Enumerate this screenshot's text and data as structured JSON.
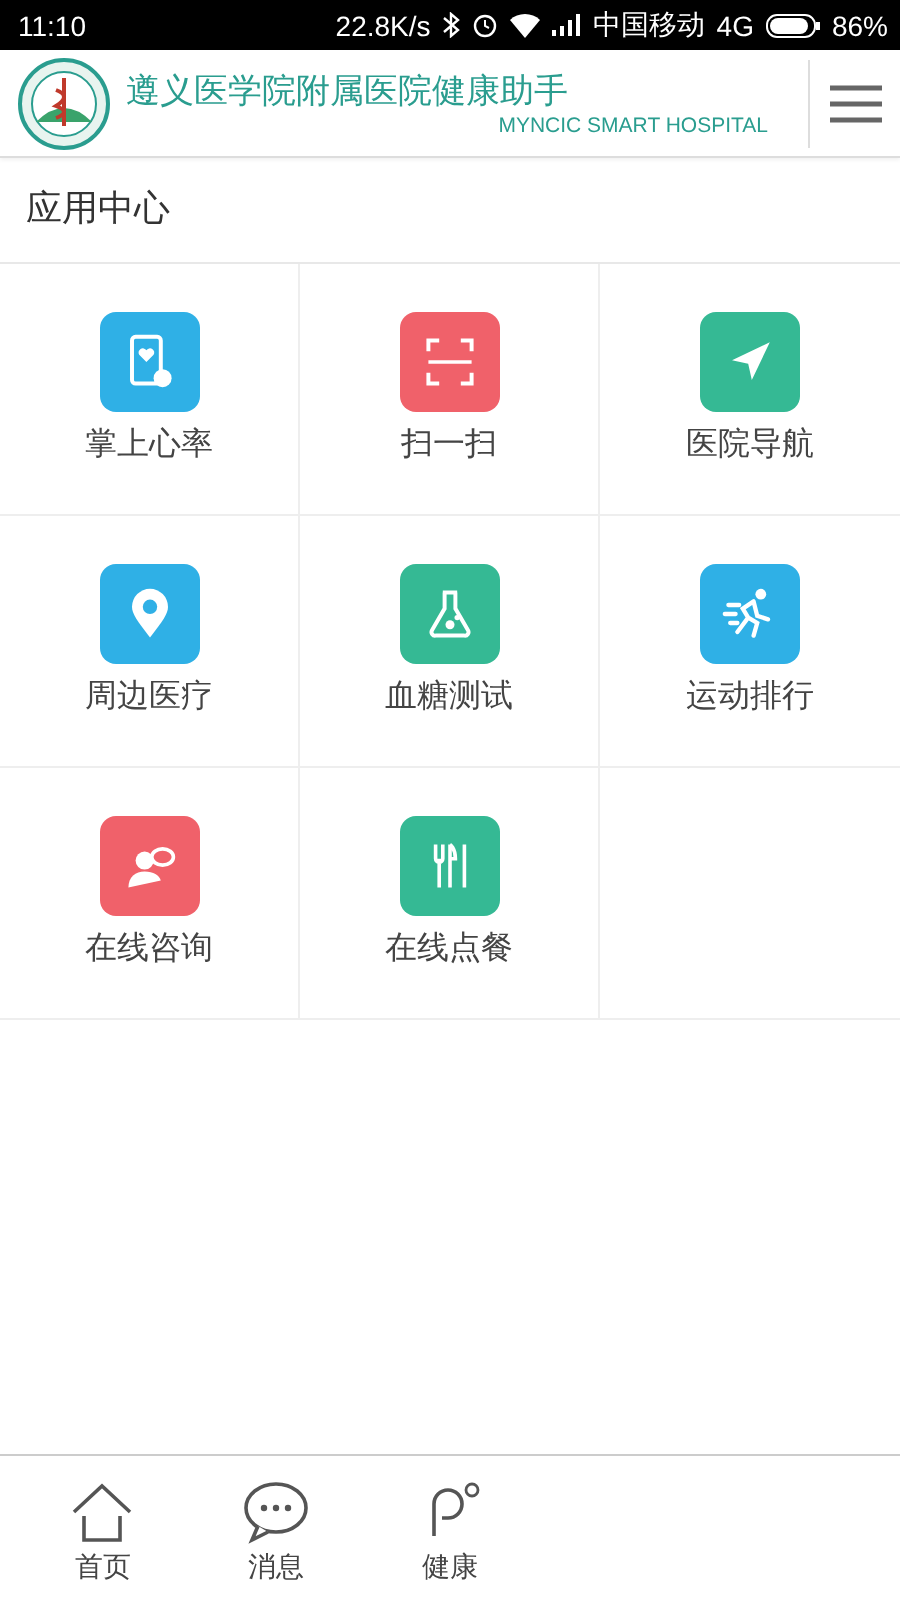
{
  "status_bar": {
    "time": "11:10",
    "speed": "22.8K/s",
    "carrier": "中国移动",
    "network": "4G",
    "battery": "86%"
  },
  "header": {
    "title": "遵义医学院附属医院健康助手",
    "subtitle": "MYNCIC SMART HOSPITAL"
  },
  "section": {
    "title": "应用中心"
  },
  "apps": [
    {
      "label": "掌上心率",
      "kind": "heart-phone",
      "color": "#2fb0e6"
    },
    {
      "label": "扫一扫",
      "kind": "scan",
      "color": "#f0616a"
    },
    {
      "label": "医院导航",
      "kind": "navigate",
      "color": "#35b994"
    },
    {
      "label": "周边医疗",
      "kind": "pin",
      "color": "#2fb0e6"
    },
    {
      "label": "血糖测试",
      "kind": "flask",
      "color": "#35b994"
    },
    {
      "label": "运动排行",
      "kind": "runner",
      "color": "#2fb0e6"
    },
    {
      "label": "在线咨询",
      "kind": "consult",
      "color": "#f0616a"
    },
    {
      "label": "在线点餐",
      "kind": "cutlery",
      "color": "#35b994"
    }
  ],
  "tab_bar": [
    {
      "label": "首页",
      "kind": "home"
    },
    {
      "label": "消息",
      "kind": "chat"
    },
    {
      "label": "健康",
      "kind": "health"
    }
  ]
}
